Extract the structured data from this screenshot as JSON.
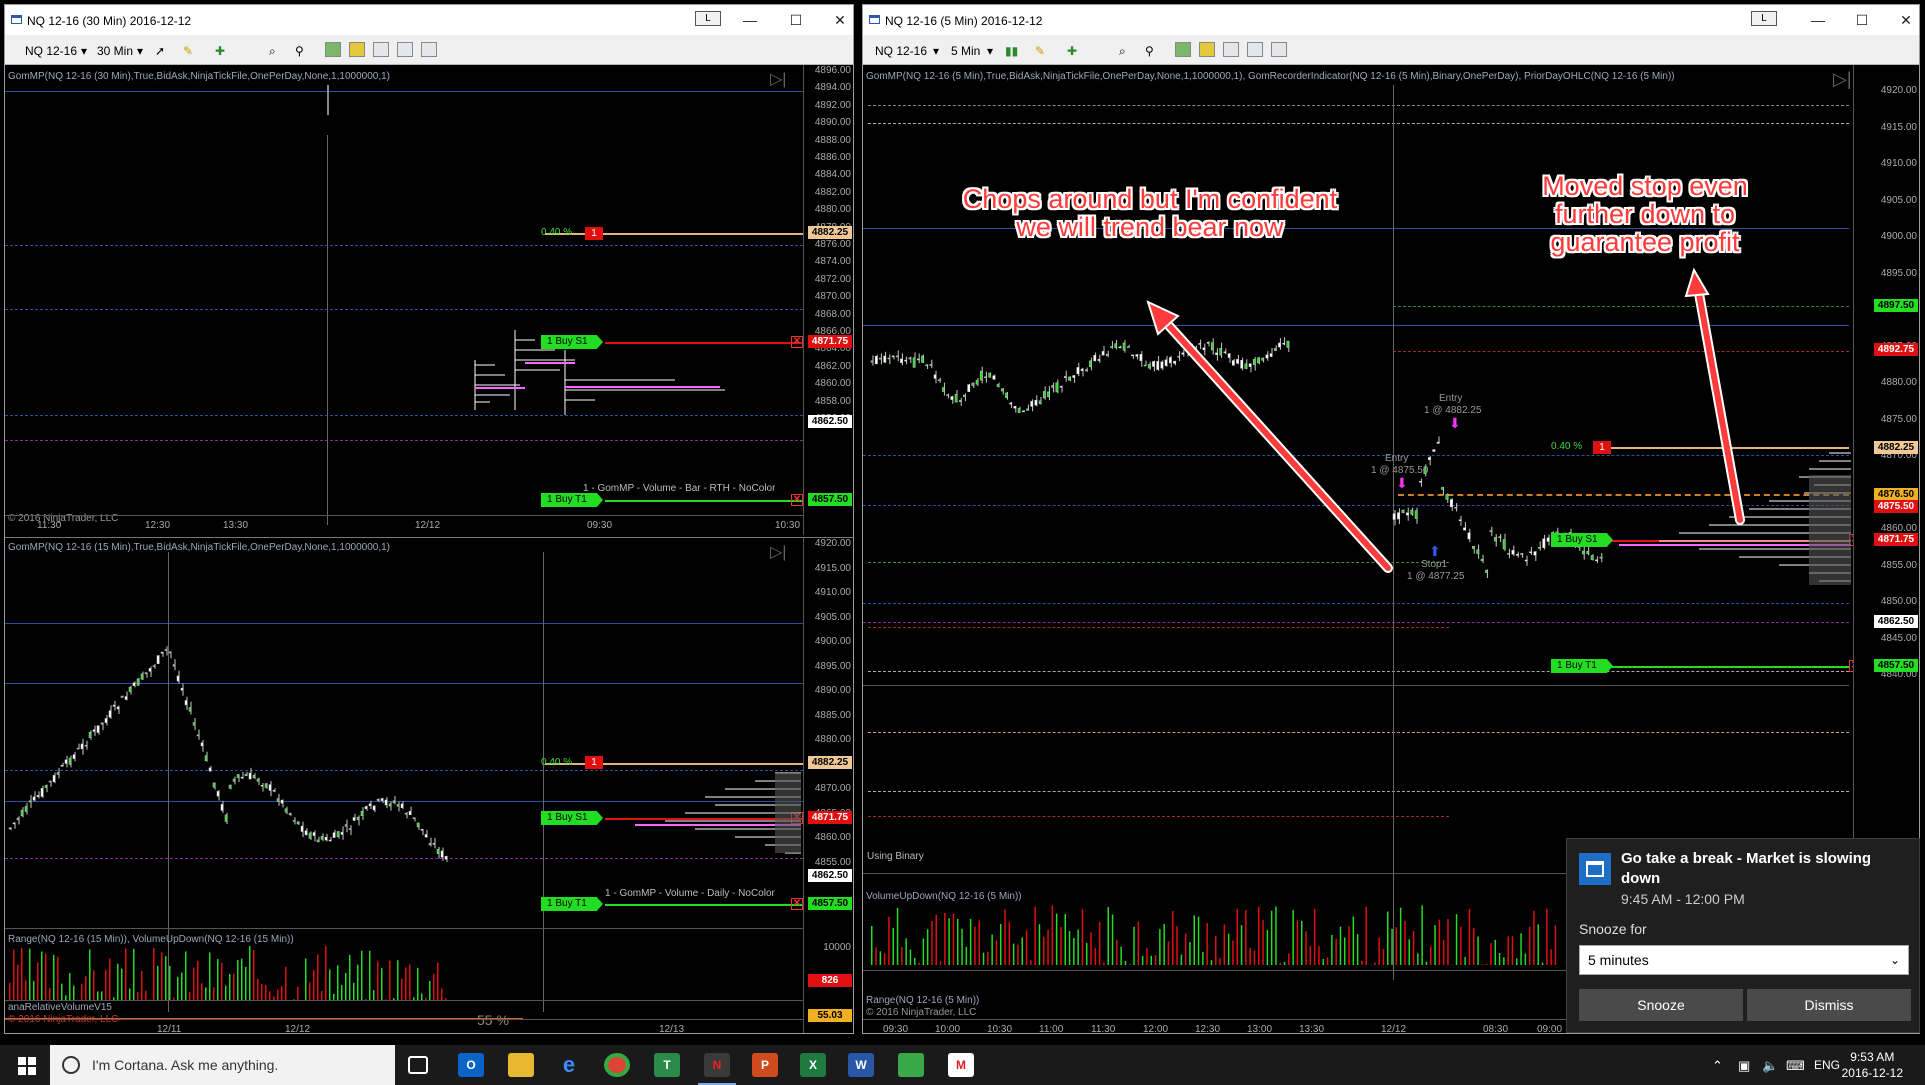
{
  "colors": {
    "chart_bg": "#000000",
    "bull": "#22dd22",
    "bear": "#e01010",
    "pink": "#ff66ff",
    "annotation": "#ff3b3b",
    "toast_bg": "#1f1f1f"
  },
  "left_window": {
    "title": "NQ 12-16 (30 Min)  2016-12-12",
    "lock_label": "L",
    "instrument": "NQ 12-16",
    "interval": "30 Min",
    "top_panel": {
      "indicator": "GomMP(NQ 12-16 (30 Min),True,BidAsk,NinjaTickFile,OnePerDay,None,1,1000000,1)",
      "ticks": [
        "4896.00",
        "4894.00",
        "4892.00",
        "4890.00",
        "4888.00",
        "4886.00",
        "4884.00",
        "4882.00",
        "4880.00",
        "4878.00",
        "4876.00",
        "4874.00",
        "4872.00",
        "4870.00",
        "4868.00",
        "4866.00",
        "4864.00",
        "4862.00",
        "4860.00",
        "4858.00",
        "4856.00"
      ],
      "tag_4882": "4882.25",
      "tag_4871": "4871.75",
      "tag_4862": "4862.50",
      "tag_4857": "4857.50",
      "pct": "0.40 %",
      "red_qty": "1",
      "stop_label": "1  Buy S1",
      "target_label": "1  Buy T1",
      "profile_label": "1 - GomMP - Volume - Bar - RTH - NoColor",
      "copyright": "© 2016 NinjaTrader, LLC",
      "times": [
        "11:30",
        "12:30",
        "13:30",
        "12/12",
        "09:30",
        "10:30"
      ]
    },
    "bottom_panel": {
      "indicator": "GomMP(NQ 12-16 (15 Min),True,BidAsk,NinjaTickFile,OnePerDay,None,1,1000000,1)",
      "ticks": [
        "4920.00",
        "4915.00",
        "4910.00",
        "4905.00",
        "4900.00",
        "4895.00",
        "4890.00",
        "4885.00",
        "4880.00",
        "4875.00",
        "4870.00",
        "4865.00",
        "4860.00",
        "4855.00"
      ],
      "tag_4882": "4882.25",
      "tag_4871": "4871.75",
      "tag_4862": "4862.50",
      "tag_4857": "4857.50",
      "pct": "0.40 %",
      "red_qty": "1",
      "stop_label": "1  Buy S1",
      "target_label": "1  Buy T1",
      "profile_label": "1 - GomMP - Volume - Daily - NoColor",
      "sub_indicator": "Range(NQ 12-16 (15 Min)), VolumeUpDown(NQ 12-16 (15 Min))",
      "sub_tick": "10000",
      "sub_tag": "826",
      "rel_indicator": "anaRelativeVolumeV15",
      "rel_copyright": "© 2016 NinjaTrader, LLC",
      "rel_pct": "55 %",
      "rel_tag": "55.03",
      "times": [
        "12/11",
        "12/12",
        "12/13"
      ]
    }
  },
  "right_window": {
    "title": "NQ 12-16 (5 Min)  2016-12-12",
    "lock_label": "L",
    "instrument": "NQ 12-16",
    "interval": "5 Min",
    "indicator": "GomMP(NQ 12-16 (5 Min),True,BidAsk,NinjaTickFile,OnePerDay,None,1,1000000,1), GomRecorderIndicator(NQ 12-16 (5 Min),Binary,OnePerDay), PriorDayOHLC(NQ 12-16 (5 Min))",
    "ticks": [
      "4920.00",
      "4915.00",
      "4910.00",
      "4905.00",
      "4900.00",
      "4895.00",
      "4890.00",
      "4885.00",
      "4880.00",
      "4875.00",
      "4870.00",
      "4865.00",
      "4860.00",
      "4855.00",
      "4850.00",
      "4845.00",
      "4840.00"
    ],
    "tag_4897": "4897.50",
    "tag_4892": "4892.75",
    "tag_4882": "4882.25",
    "tag_4876": "4876.50",
    "tag_4875": "4875.50",
    "tag_4871": "4871.75",
    "tag_4862": "4862.50",
    "tag_4857": "4857.50",
    "pct": "0.40 %",
    "red_qty": "1",
    "stop_label": "1  Buy S1",
    "target_label": "1  Buy T1",
    "entry1_title": "Entry",
    "entry1_label": "1 @ 4875.50",
    "entry2_title": "Entry",
    "entry2_label": "1 @ 4882.25",
    "stop_fill_title": "Stop1",
    "stop_fill_label": "1 @ 4877.25",
    "using_binary": "Using Binary",
    "vol_indicator": "VolumeUpDown(NQ 12-16 (5 Min))",
    "range_indicator": "Range(NQ 12-16 (5 Min))",
    "copyright": "© 2016 NinjaTrader, LLC",
    "times": [
      "09:30",
      "10:00",
      "10:30",
      "11:00",
      "11:30",
      "12:00",
      "12:30",
      "13:00",
      "13:30",
      "12/12",
      "08:30",
      "09:00"
    ]
  },
  "annotations": {
    "left_note": "Chops around but I'm confident we will trend bear now",
    "right_note": "Moved stop even further down to guarantee profit"
  },
  "toast": {
    "title": "Go take a break - Market is slowing down",
    "time": "9:45 AM - 12:00 PM",
    "snooze_label": "Snooze for",
    "snooze_value": "5 minutes",
    "snooze_button": "Snooze",
    "dismiss_button": "Dismiss"
  },
  "taskbar": {
    "cortana": "I'm Cortana. Ask me anything.",
    "lang": "ENG",
    "time": "9:53 AM",
    "date": "2016-12-12"
  }
}
